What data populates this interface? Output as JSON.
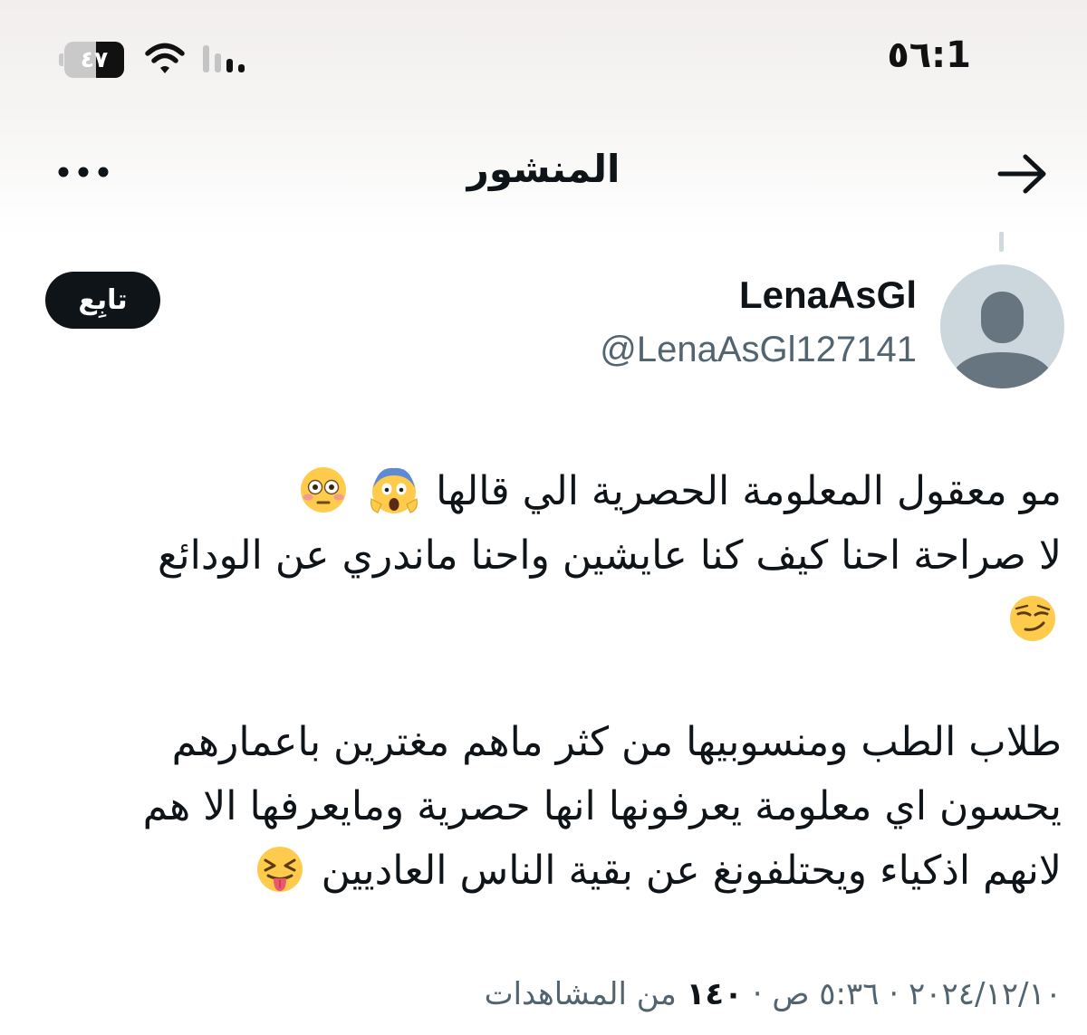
{
  "status_bar": {
    "time": "1:٥٦",
    "battery_level": "٤٧",
    "battery_fraction": 0.47
  },
  "nav": {
    "title": "المنشور",
    "back_icon": "arrow-right-icon",
    "more_icon": "more-horizontal-icon"
  },
  "author": {
    "display_name": "LenaAsGl",
    "handle": "@LenaAsGl127141",
    "follow_label": "تابِع"
  },
  "post": {
    "line1": "مو معقول المعلومة الحصرية الي قالها",
    "line1_emojis": [
      "face-screaming-in-fear",
      "flushed-face"
    ],
    "line2": "لا صراحة احنا كيف كنا عايشين واحنا ماندري عن الودائع",
    "line3_emojis": [
      "smirking-face"
    ],
    "line4": "طلاب الطب ومنسوبيها من كثر ماهم مغترين باعمارهم",
    "line5": "يحسون اي معلومة يعرفونها انها حصرية ومايعرفها الا هم",
    "line6": "لانهم اذكياء ويحتلفونغ عن بقية الناس العاديين",
    "line6_emojis": [
      "squinting-face-with-tongue"
    ]
  },
  "meta": {
    "date": "٢٠٢٤/١٢/١٠",
    "separator": "·",
    "time": "٥:٣٦ ص",
    "views_count": "١٤٠",
    "views_label": "من المشاهدات"
  },
  "colors": {
    "text_primary": "#0f1419",
    "text_secondary": "#536471",
    "follow_bg": "#0f1419",
    "avatar_bg": "#ccd6dd",
    "avatar_figure": "#66757f"
  }
}
